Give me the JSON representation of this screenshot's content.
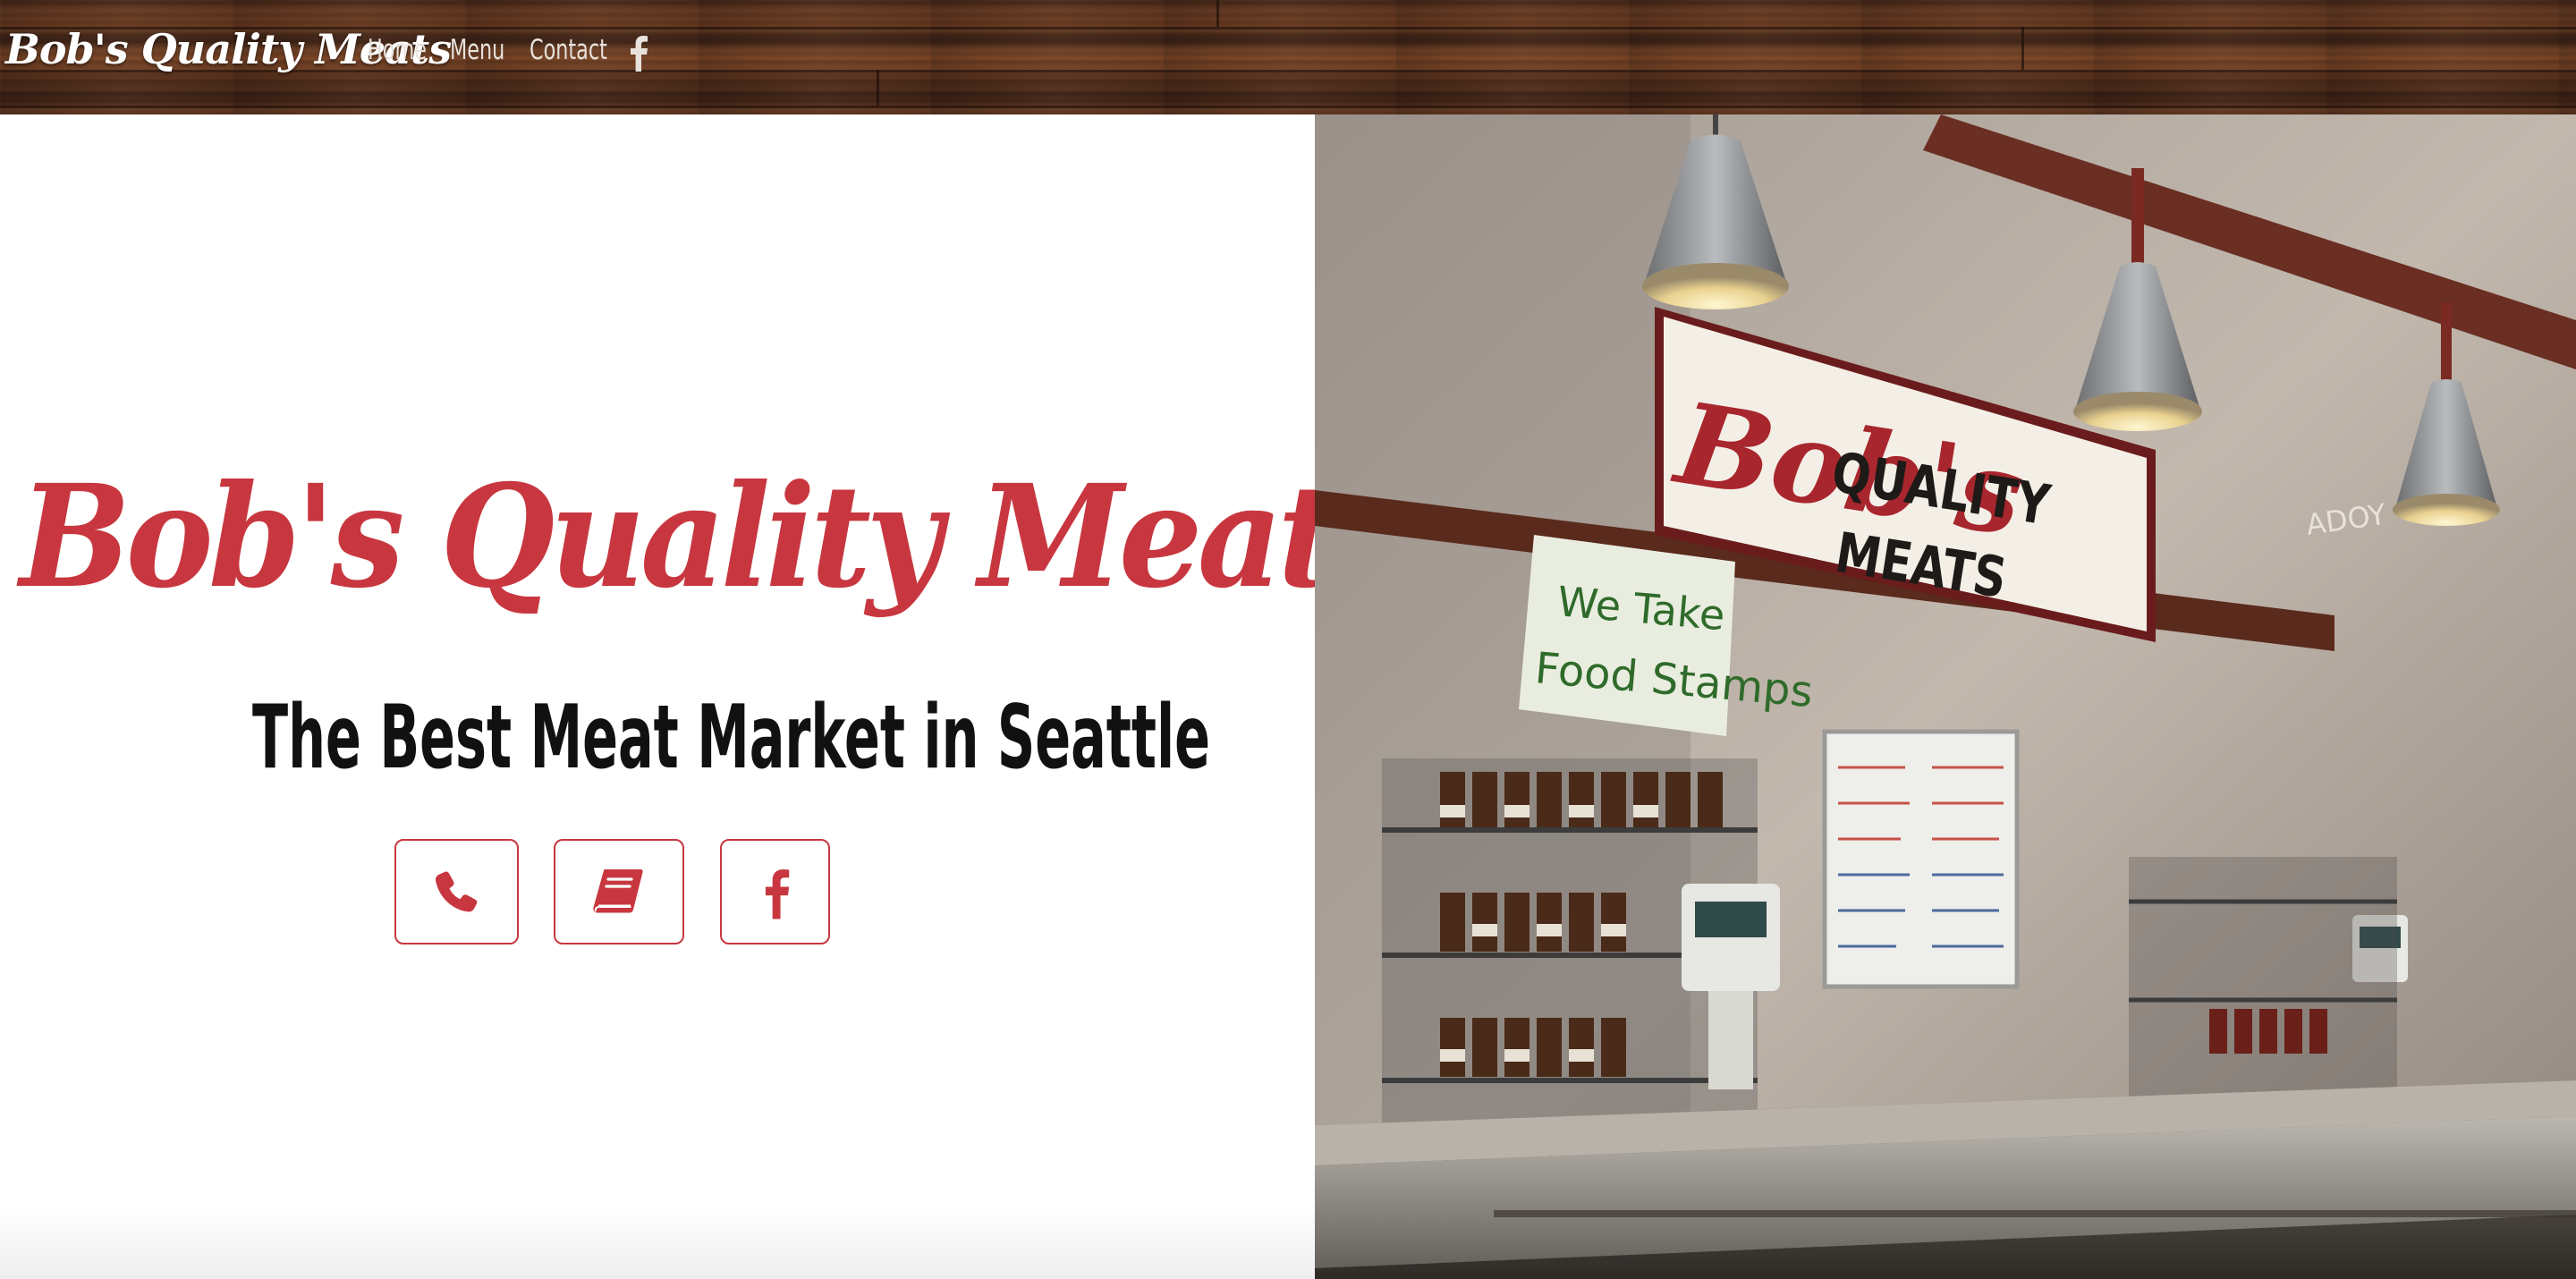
{
  "nav": {
    "brand": "Bob's Quality Meats",
    "links": [
      "Home",
      "Menu",
      "Contact"
    ],
    "facebook_icon": "facebook-icon"
  },
  "hero": {
    "title": "Bob's Quality Meats",
    "subtitle": "The Best Meat Market in Seattle",
    "buttons": [
      {
        "icon": "phone-icon"
      },
      {
        "icon": "book-icon"
      },
      {
        "icon": "facebook-icon"
      }
    ]
  },
  "photo": {
    "sign_script": "Bob's",
    "sign_line1": "QUALITY",
    "sign_line2": "MEATS",
    "poster_line1": "We Take",
    "poster_line2": "Food Stamps",
    "wall_text": "ADOY"
  },
  "colors": {
    "accent": "#c8373f",
    "text_dark": "#111111",
    "nav_text": "#e8e2dc"
  }
}
